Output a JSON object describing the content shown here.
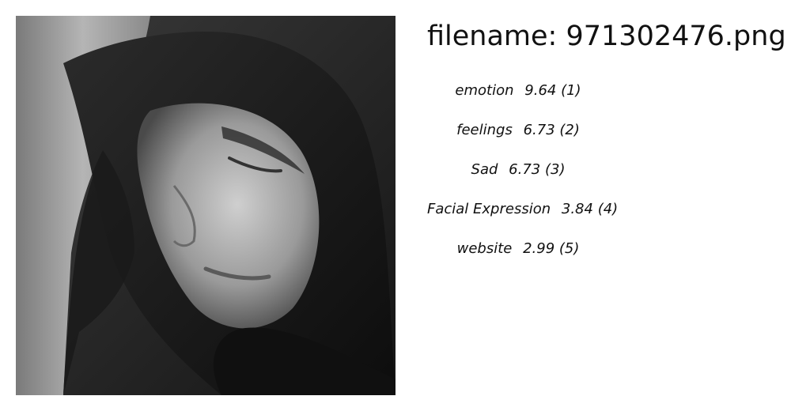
{
  "image": {
    "filename_label": "filename:",
    "filename": "971302476.png"
  },
  "tags": [
    {
      "label": "emotion",
      "score": "9.64",
      "rank": "(1)"
    },
    {
      "label": "feelings",
      "score": "6.73",
      "rank": "(2)"
    },
    {
      "label": "Sad",
      "score": "6.73",
      "rank": "(3)"
    },
    {
      "label": "Facial Expression",
      "score": "3.84",
      "rank": "(4)"
    },
    {
      "label": "website",
      "score": "2.99",
      "rank": "(5)"
    }
  ]
}
